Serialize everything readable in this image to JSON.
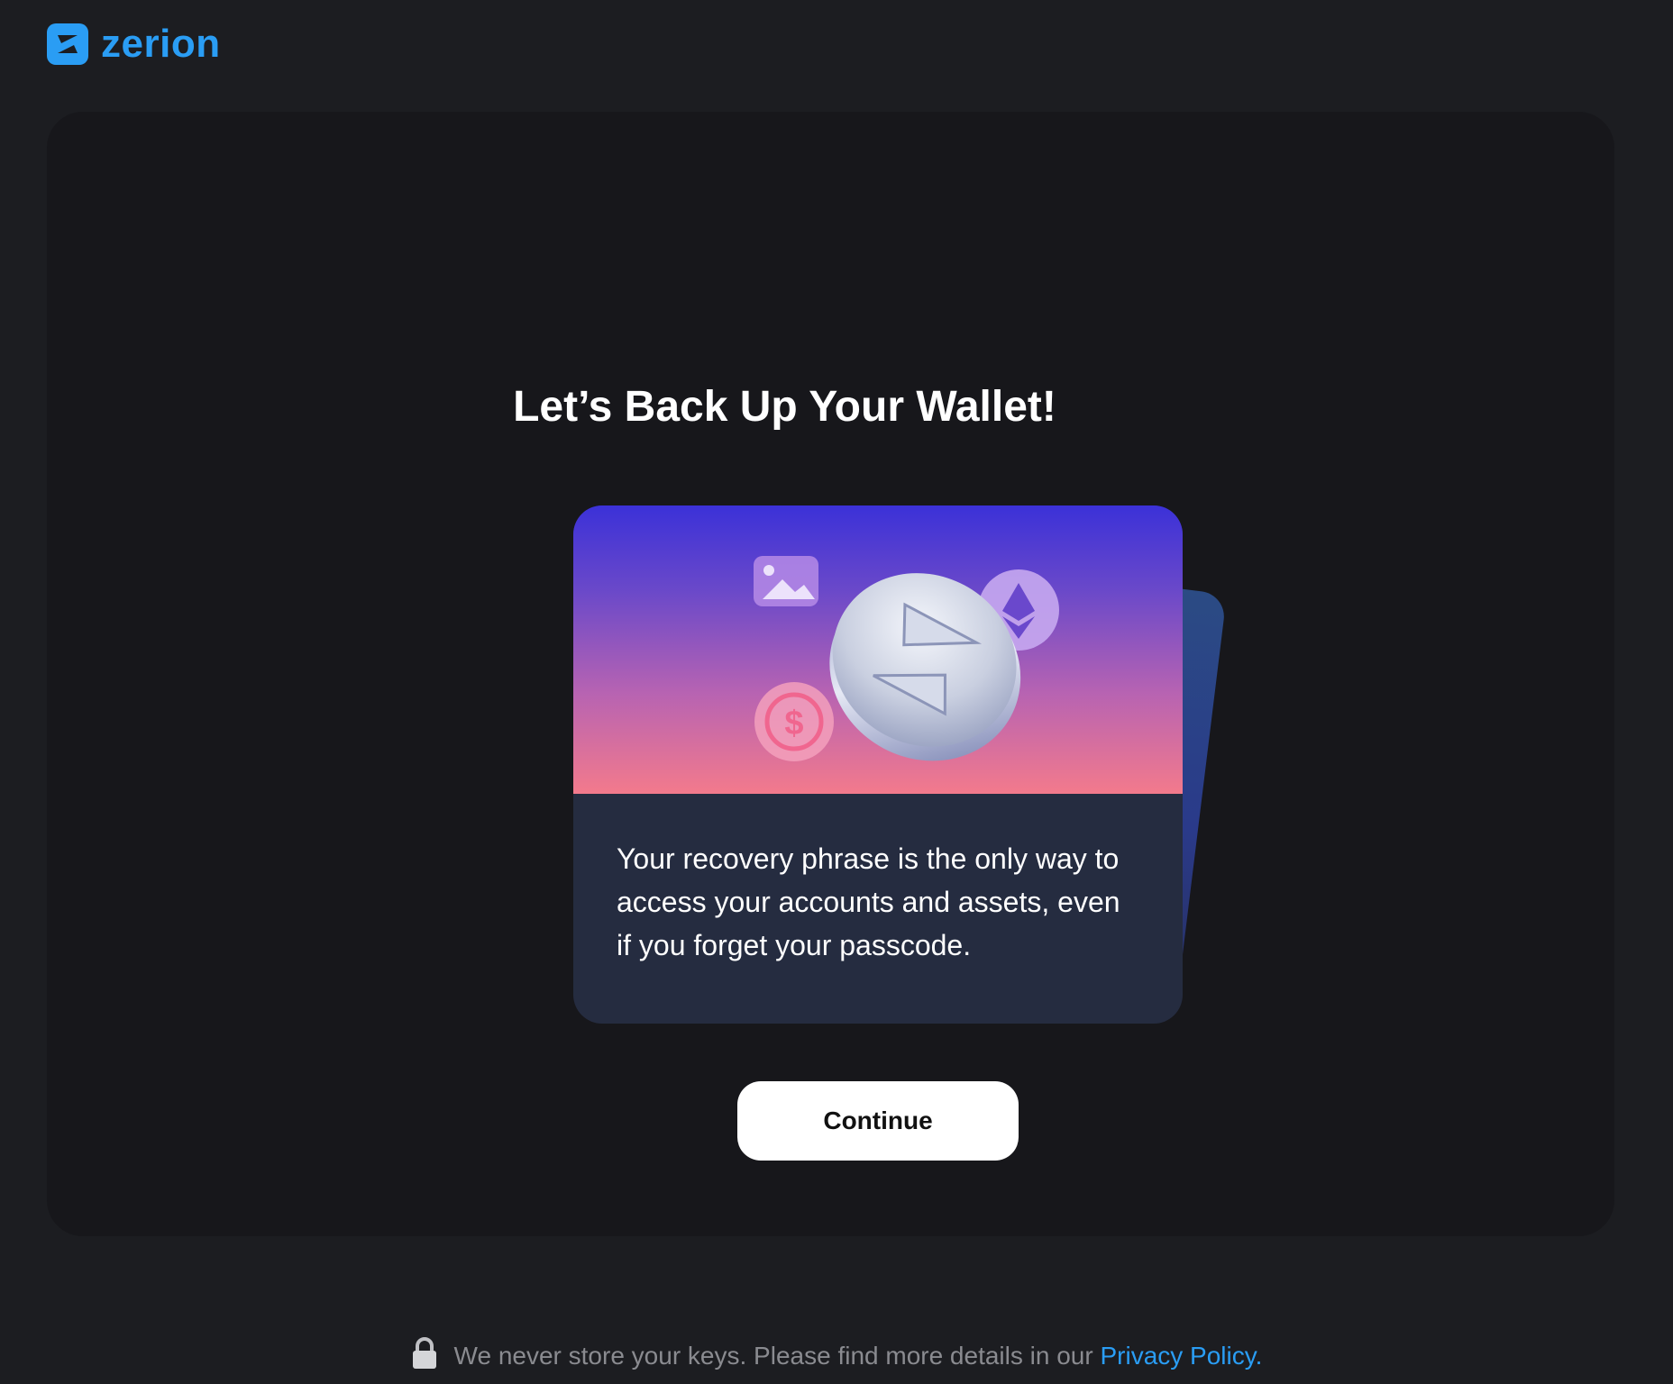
{
  "brand": {
    "name": "zerion",
    "color": "#2a9df4",
    "icon": "zerion-logo-icon"
  },
  "main": {
    "title": "Let’s Back Up Your Wallet!",
    "card": {
      "description": "Your recovery phrase is the only way to access your accounts and assets, even if you forget your passcode.",
      "illustration_icons": [
        "image-icon",
        "zerion-coin-icon",
        "ethereum-icon",
        "usdc-dollar-icon"
      ]
    },
    "continue_label": "Continue"
  },
  "footer": {
    "lock_icon": "lock-icon",
    "notice": "We never store your keys. Please find more details in our ",
    "link_label": "Privacy Policy",
    "suffix": "."
  }
}
